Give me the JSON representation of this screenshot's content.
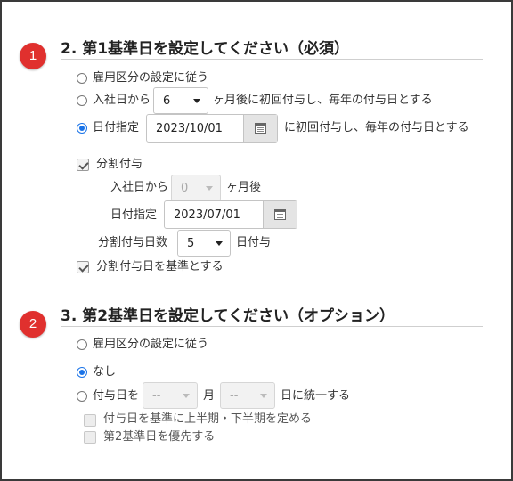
{
  "section2": {
    "badge": "1",
    "title": "2. 第1基準日を設定してください（必須）",
    "opt_employment": "雇用区分の設定に従う",
    "opt_join_prefix": "入社日から",
    "opt_join_months": "6",
    "opt_join_suffix": "ヶ月後に初回付与し、毎年の付与日とする",
    "opt_date_label": "日付指定",
    "opt_date_value": "2023/10/01",
    "opt_date_suffix": "に初回付与し、毎年の付与日とする",
    "split": {
      "label": "分割付与",
      "join_label": "入社日から",
      "join_months": "0",
      "join_suffix": "ヶ月後",
      "date_label": "日付指定",
      "date_value": "2023/07/01",
      "days_label": "分割付与日数",
      "days_value": "5",
      "days_suffix": "日付与",
      "base_label": "分割付与日を基準とする"
    }
  },
  "section3": {
    "badge": "2",
    "title": "3. 第2基準日を設定してください（オプション）",
    "opt_employment": "雇用区分の設定に従う",
    "opt_none": "なし",
    "opt_grant_prefix": "付与日を",
    "month_value": "--",
    "month_label": "月",
    "day_value": "--",
    "day_suffix": "日に統一する",
    "half_label": "付与日を基準に上半期・下半期を定める",
    "priority_label": "第2基準日を優先する"
  },
  "colors": {
    "badge": "#e0302e",
    "radio_selected": "#1a73e8"
  },
  "icons": {
    "calendar": "calendar-icon",
    "dropdown": "chevron-down-icon"
  }
}
